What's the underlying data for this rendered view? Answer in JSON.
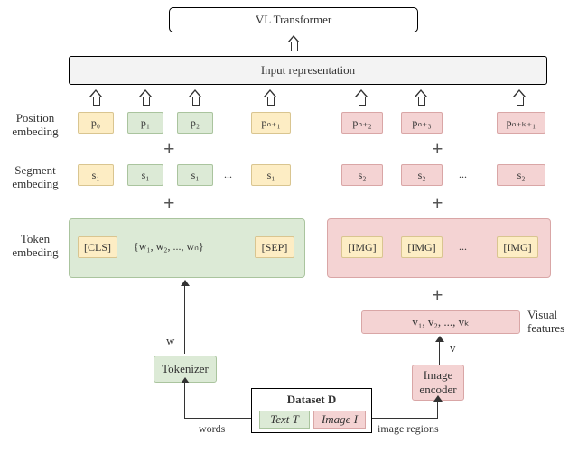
{
  "top": {
    "vl_transformer": "VL Transformer",
    "input_rep": "Input representation"
  },
  "labels": {
    "position": "Position\nembeding",
    "segment": "Segment\nembeding",
    "token": "Token\nembeding",
    "visual_features": "Visual\nfeatures",
    "tokenizer": "Tokenizer",
    "image_encoder": "Image\nencoder",
    "dataset": "Dataset D",
    "text_t": "Text T",
    "image_i": "Image I",
    "words": "words",
    "image_regions": "image regions",
    "w_label": "w",
    "v_label": "v"
  },
  "position_row": [
    "p₀",
    "p₁",
    "p₂",
    "pₙ₊₁",
    "pₙ₊₂",
    "pₙ₊₃",
    "pₙ₊ₖ₊₁"
  ],
  "segment_row": [
    "s₁",
    "s₁",
    "s₁",
    "...",
    "s₁",
    "s₂",
    "s₂",
    "...",
    "s₂"
  ],
  "token_row": {
    "cls": "[CLS]",
    "words": "{w₁, w₂, ..., wₙ}",
    "sep": "[SEP]",
    "img": "[IMG]",
    "dots": "..."
  },
  "visual_box": "v₁, v₂, ..., vₖ",
  "plus": "+"
}
